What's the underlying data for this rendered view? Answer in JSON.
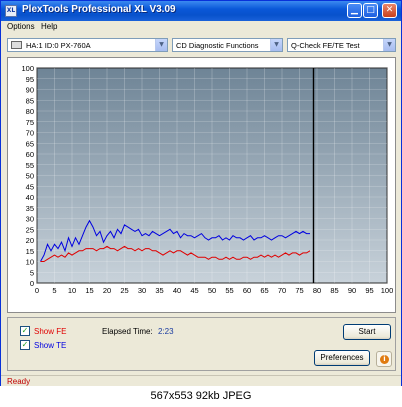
{
  "window": {
    "title": "PlexTools Professional XL V3.09",
    "icon_text": "XL",
    "title_color": "#0a58d8"
  },
  "menu": {
    "items": [
      {
        "label": "Options"
      },
      {
        "label": "Help"
      }
    ]
  },
  "toolbar": {
    "drive": "HA:1 ID:0  PX-760A",
    "function": "CD Diagnostic Functions",
    "test": "Q-Check FE/TE Test"
  },
  "controls": {
    "show_fe_label": "Show FE",
    "show_fe_checked": true,
    "show_te_label": "Show TE",
    "show_te_checked": true,
    "elapsed_label": "Elapsed Time:",
    "elapsed_value": "2:23",
    "start_label": "Start",
    "preferences_label": "Preferences",
    "fe_color": "#e00000",
    "te_color": "#0000e0"
  },
  "status": {
    "text": "Ready",
    "color": "#c00000"
  },
  "caption": {
    "text": "567x553 92kb JPEG"
  },
  "chart_data": {
    "type": "line",
    "xlim": [
      0,
      100
    ],
    "ylim": [
      0,
      100
    ],
    "x_ticks": [
      0,
      5,
      10,
      15,
      20,
      25,
      30,
      35,
      40,
      45,
      50,
      55,
      60,
      65,
      70,
      75,
      80,
      85,
      90,
      95,
      100
    ],
    "y_ticks": [
      0,
      5,
      10,
      15,
      20,
      25,
      30,
      35,
      40,
      45,
      50,
      55,
      60,
      65,
      70,
      75,
      80,
      85,
      90,
      95,
      100
    ],
    "grid": true,
    "plot_bg": "#ffffff",
    "plot_fill_gradient": [
      "#c8d2da",
      "#6e8496"
    ],
    "marker_x": 79,
    "series": [
      {
        "name": "TE",
        "color": "#0000e0",
        "x": [
          1,
          2,
          3,
          4,
          5,
          6,
          7,
          8,
          9,
          10,
          11,
          12,
          13,
          14,
          15,
          16,
          17,
          18,
          19,
          20,
          21,
          22,
          23,
          24,
          25,
          26,
          27,
          28,
          29,
          30,
          31,
          32,
          33,
          34,
          35,
          36,
          37,
          38,
          39,
          40,
          41,
          42,
          43,
          44,
          45,
          46,
          47,
          48,
          49,
          50,
          51,
          52,
          53,
          54,
          55,
          56,
          57,
          58,
          59,
          60,
          61,
          62,
          63,
          64,
          65,
          66,
          67,
          68,
          69,
          70,
          71,
          72,
          73,
          74,
          75,
          76,
          77,
          78
        ],
        "y": [
          10,
          13,
          18,
          15,
          18,
          16,
          19,
          15,
          21,
          17,
          21,
          18,
          22,
          26,
          29,
          26,
          22,
          24,
          19,
          22,
          24,
          21,
          25,
          23,
          27,
          26,
          25,
          24,
          25,
          22,
          23,
          22,
          24,
          23,
          22,
          23,
          24,
          25,
          23,
          24,
          21,
          23,
          22,
          22,
          21,
          22,
          23,
          21,
          20,
          21,
          21,
          22,
          20,
          21,
          20,
          22,
          21,
          21,
          20,
          21,
          22,
          20,
          21,
          21,
          22,
          21,
          20,
          21,
          22,
          22,
          21,
          22,
          23,
          24,
          23,
          24,
          23,
          23
        ]
      },
      {
        "name": "FE",
        "color": "#e00000",
        "x": [
          1,
          2,
          3,
          4,
          5,
          6,
          7,
          8,
          9,
          10,
          11,
          12,
          13,
          14,
          15,
          16,
          17,
          18,
          19,
          20,
          21,
          22,
          23,
          24,
          25,
          26,
          27,
          28,
          29,
          30,
          31,
          32,
          33,
          34,
          35,
          36,
          37,
          38,
          39,
          40,
          41,
          42,
          43,
          44,
          45,
          46,
          47,
          48,
          49,
          50,
          51,
          52,
          53,
          54,
          55,
          56,
          57,
          58,
          59,
          60,
          61,
          62,
          63,
          64,
          65,
          66,
          67,
          68,
          69,
          70,
          71,
          72,
          73,
          74,
          75,
          76,
          77,
          78
        ],
        "y": [
          10,
          10,
          11,
          12,
          13,
          12,
          13,
          12,
          14,
          13,
          14,
          15,
          15,
          16,
          16,
          16,
          15,
          16,
          16,
          17,
          16,
          16,
          15,
          16,
          17,
          16,
          16,
          15,
          16,
          15,
          16,
          16,
          15,
          15,
          14,
          13,
          14,
          15,
          14,
          15,
          15,
          14,
          13,
          14,
          13,
          12,
          12,
          12,
          11,
          12,
          12,
          11,
          11,
          12,
          11,
          12,
          11,
          11,
          12,
          12,
          11,
          12,
          12,
          13,
          12,
          13,
          12,
          13,
          12,
          13,
          14,
          13,
          14,
          14,
          13,
          14,
          14,
          15
        ]
      }
    ]
  }
}
